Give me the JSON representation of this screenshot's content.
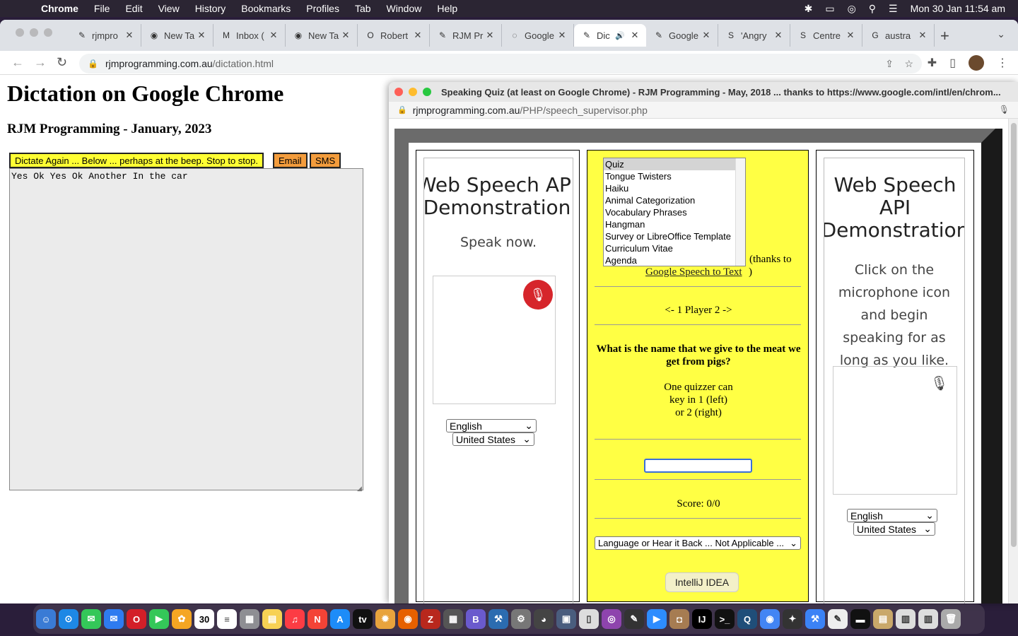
{
  "menubar": {
    "app": "Chrome",
    "items": [
      "File",
      "Edit",
      "View",
      "History",
      "Bookmarks",
      "Profiles",
      "Tab",
      "Window",
      "Help"
    ],
    "clock": "Mon 30 Jan  11:54 am"
  },
  "tabs": [
    {
      "label": "rjmpro",
      "icon": "rjm-icon"
    },
    {
      "label": "New Ta",
      "icon": "chrome-icon"
    },
    {
      "label": "Inbox (",
      "icon": "gmail-icon"
    },
    {
      "label": "New Ta",
      "icon": "chrome-icon"
    },
    {
      "label": "Robert",
      "icon": "o-icon"
    },
    {
      "label": "RJM Pr",
      "icon": "rjm-icon"
    },
    {
      "label": "Google",
      "icon": "loading-icon"
    },
    {
      "label": "Dic",
      "icon": "rjm-icon",
      "active": true
    },
    {
      "label": "Google",
      "icon": "rjm-icon"
    },
    {
      "label": "'Angry",
      "icon": "s-icon"
    },
    {
      "label": "Centre",
      "icon": "s-icon"
    },
    {
      "label": "austra",
      "icon": "google-icon"
    }
  ],
  "url": {
    "host": "rjmprogramming.com.au",
    "path": "/dictation.html"
  },
  "page": {
    "title": "Dictation on Google Chrome",
    "subtitle": "RJM Programming - January, 2023",
    "dictate_label": "Dictate Again ... Below ... perhaps at the beep.  Stop to stop.",
    "email_label": "Email",
    "sms_label": "SMS",
    "dictation_text": "Yes Ok Yes Ok Another In the car"
  },
  "popup": {
    "title": "Speaking Quiz (at least on Google Chrome) - RJM Programming - May, 2018 ... thanks to https://www.google.com/intl/en/chrom...",
    "url_host": "rjmprogramming.com.au",
    "url_path": "/PHP/speech_supervisor.php",
    "left_panel": {
      "title": "Web Speech API Demonstration",
      "prompt": "Speak now.",
      "language": "English",
      "dialect": "United States"
    },
    "center": {
      "list_options": [
        "Quiz",
        "Tongue Twisters",
        "Haiku",
        "Animal Categorization",
        "Vocabulary Phrases",
        "Hangman",
        "Survey or LibreOffice Template",
        "Curriculum Vitae",
        "Agenda"
      ],
      "thanks_prefix": "(thanks to",
      "thanks_link": "Google Speech to Text",
      "thanks_suffix": ")",
      "players": "<- 1 Player 2 ->",
      "question": "What is the name that we give to the meat we get from pigs?",
      "instructions_1": "One quizzer can",
      "instructions_2": "key in 1 (left)",
      "instructions_3": "or 2 (right)",
      "answer_value": "",
      "score": "Score: 0/0",
      "hear_select": "Language or Hear it Back ... Not Applicable ..."
    },
    "right_panel": {
      "title": "Web Speech API Demonstration",
      "prompt": "Click on the microphone icon and begin speaking for as long as you like.",
      "language": "English",
      "dialect": "United States"
    }
  },
  "tooltip": "IntelliJ IDEA",
  "colors": {
    "yellow": "#ffff44",
    "orange": "#f39c3c",
    "mic_red": "#d6252b"
  }
}
